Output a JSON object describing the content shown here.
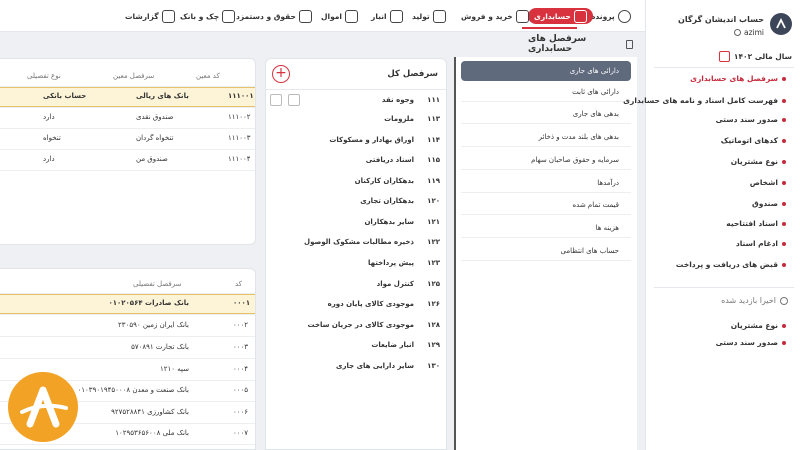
{
  "sidebar": {
    "company": "حساب اندیشان گرگان",
    "user": "azimi",
    "fiscal_year": "سال مالی ۱۴۰۲",
    "items": [
      {
        "label": "سرفصل های حسابداری",
        "active": true
      },
      {
        "label": "فهرست کامل اسناد و نامه های حسابداری"
      },
      {
        "label": "صدور سند دستی"
      },
      {
        "label": "کدهای اتوماتیک"
      },
      {
        "label": "نوع مشتریان"
      },
      {
        "label": "اشخاص"
      },
      {
        "label": "صندوق"
      },
      {
        "label": "اسناد افتتاحیه"
      },
      {
        "label": "ادغام اسناد"
      },
      {
        "label": "قبض های دریافت و پرداخت"
      }
    ],
    "recent_title": "اخیرا بازدید شده",
    "recent": [
      "نوع مشتریان",
      "صدور سند دستی"
    ]
  },
  "topnav": [
    {
      "label": "پرونده"
    },
    {
      "label": "حسابداری",
      "active": true
    },
    {
      "label": "خرید و فروش"
    },
    {
      "label": "تولید"
    },
    {
      "label": "انبار"
    },
    {
      "label": "اموال"
    },
    {
      "label": "حقوق و دستمزد"
    },
    {
      "label": "چک و بانک"
    },
    {
      "label": "گزارشات"
    }
  ],
  "page_title": "سرفصل های حسابداری",
  "groups": [
    "دارائی های جاری",
    "دارائی های ثابت",
    "بدهی های جاری",
    "بدهی های بلند مدت و ذخائر",
    "سرمایه و حقوق صاحبان سهام",
    "درآمدها",
    "قیمت تمام شده",
    "هزینه ها",
    "حساب های انتظامی"
  ],
  "kol": {
    "title": "سرفصل کل",
    "rows": [
      {
        "code": "۱۱۱",
        "name": "وجوه نقد"
      },
      {
        "code": "۱۱۳",
        "name": "ملزومات"
      },
      {
        "code": "۱۱۴",
        "name": "اوراق بهادار و مسکوکات"
      },
      {
        "code": "۱۱۵",
        "name": "اسناد دریافتی"
      },
      {
        "code": "۱۱۹",
        "name": "بدهکاران کارکنان"
      },
      {
        "code": "۱۲۰",
        "name": "بدهکاران تجاری"
      },
      {
        "code": "۱۲۱",
        "name": "سایر بدهکاران"
      },
      {
        "code": "۱۲۲",
        "name": "ذخیره مطالبات مشکوک الوصول"
      },
      {
        "code": "۱۲۳",
        "name": "پیش پرداختها"
      },
      {
        "code": "۱۲۵",
        "name": "کنترل مواد"
      },
      {
        "code": "۱۲۶",
        "name": "موجودی کالای پایان دوره"
      },
      {
        "code": "۱۲۸",
        "name": "موجودی کالای در جریان ساخت"
      },
      {
        "code": "۱۲۹",
        "name": "انبار ضایعات"
      },
      {
        "code": "۱۳۰",
        "name": "سایر دارایی های جاری"
      }
    ]
  },
  "moein": {
    "headers": [
      "کد معین",
      "سرفصل معین",
      "نوع تفصیلی"
    ],
    "rows": [
      {
        "code": "۱۱۱۰۰۱",
        "name": "بانک های ریالی",
        "type": "حساب بانکی",
        "selected": true
      },
      {
        "code": "۱۱۱۰۰۲",
        "name": "صندوق نقدی",
        "type": "دارد"
      },
      {
        "code": "۱۱۱۰۰۳",
        "name": "تنخواه گردان",
        "type": "تنخواه"
      },
      {
        "code": "۱۱۱۰۰۴",
        "name": "صندوق من",
        "type": "دارد"
      }
    ]
  },
  "tafsili": {
    "headers": [
      "کد",
      "سرفصل تفصیلی"
    ],
    "rows": [
      {
        "code": "۰۰۰۱",
        "name": "بانک صادرات ۰۱۰۲۰۵۶۴",
        "selected": true
      },
      {
        "code": "۰۰۰۲",
        "name": "بانک ایران زمین ۲۳۰۵۹۰"
      },
      {
        "code": "۰۰۰۳",
        "name": "بانک تجارت ۵۷۰۸۹۱"
      },
      {
        "code": "۰۰۰۴",
        "name": "سپه ۱۲۱۰"
      },
      {
        "code": "۰۰۰۵",
        "name": "بانک صنعت و معدن ۰۱۰۳۹۰۱۹۴۵۰۰۰۸"
      },
      {
        "code": "۰۰۰۶",
        "name": "بانک کشاورزی ۹۲۷۵۲۸۸۴۱"
      },
      {
        "code": "۰۰۰۷",
        "name": "بانک ملی ۱۰۲۹۵۳۶۵۶۰۰۸"
      }
    ]
  },
  "colors": {
    "accent": "#d8323f",
    "group_selected": "#5f6a7d",
    "row_selected": "#fdf4d7",
    "logo": "#f2a325"
  }
}
